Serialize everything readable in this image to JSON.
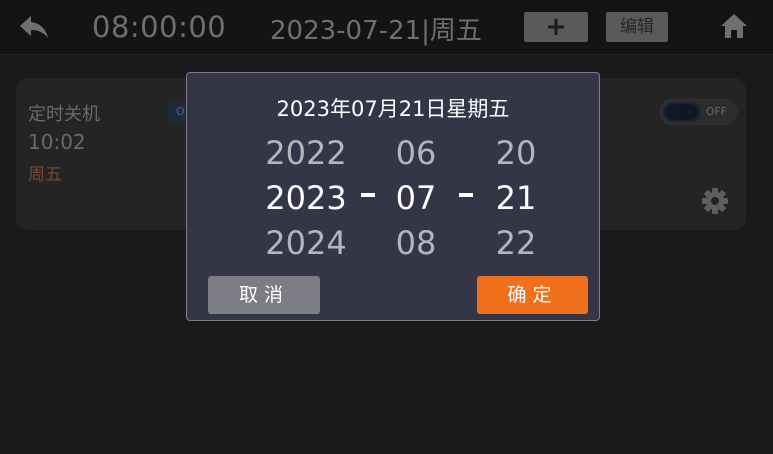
{
  "header": {
    "time": "08:00:00",
    "date": "2023-07-21|周五",
    "add_label": "+",
    "edit_label": "编辑"
  },
  "timer_card": {
    "title": "定时关机",
    "time": "10:02",
    "day": "周五",
    "left_toggle_text": "O",
    "right_toggle_text": "OFF"
  },
  "date_picker": {
    "title": "2023年07月21日星期五",
    "year": {
      "prev": "2022",
      "current": "2023",
      "next": "2024"
    },
    "month": {
      "prev": "06",
      "current": "07",
      "next": "08"
    },
    "day": {
      "prev": "20",
      "current": "21",
      "next": "22"
    },
    "cancel_label": "取消",
    "confirm_label": "确定"
  },
  "colors": {
    "background": "#1a1a1a",
    "modal_background": "#343547",
    "confirm_accent": "#f0701c",
    "cancel_button": "#7c7d84",
    "day_text": "#7a4a2e"
  }
}
